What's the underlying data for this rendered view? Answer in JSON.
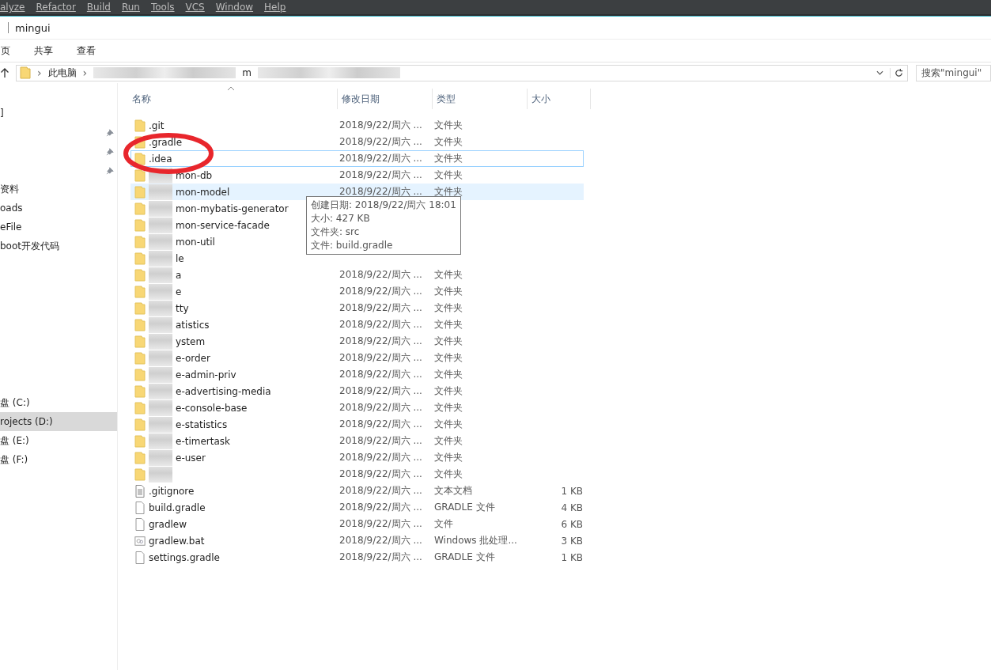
{
  "ide_menu": [
    "alyze",
    "Refactor",
    "Build",
    "Run",
    "Tools",
    "VCS",
    "Window",
    "Help"
  ],
  "window": {
    "title": "mingui"
  },
  "ribbon_tabs": [
    {
      "label": "页",
      "selected": false
    },
    {
      "label": "共享",
      "selected": false
    },
    {
      "label": "查看",
      "selected": false
    }
  ],
  "address_bar": {
    "segments": [
      {
        "kind": "chevron",
        "text": "›"
      },
      {
        "kind": "text",
        "text": "此电脑"
      },
      {
        "kind": "chevron",
        "text": "›"
      },
      {
        "kind": "redacted"
      },
      {
        "kind": "text",
        "text": "m"
      },
      {
        "kind": "redacted"
      }
    ]
  },
  "search": {
    "placeholder": "搜索\"mingui\""
  },
  "sidebar": {
    "items": [
      {
        "label": "]",
        "pinned": false,
        "selected": false
      },
      {
        "pinned": true,
        "selected": false
      },
      {
        "pinned": true,
        "selected": false
      },
      {
        "pinned": true,
        "selected": false
      },
      {
        "label": "资料",
        "pinned": false,
        "selected": false
      },
      {
        "label": "oads",
        "pinned": false,
        "selected": false
      },
      {
        "label": "eFile",
        "pinned": false,
        "selected": false
      },
      {
        "label": "boot开发代码",
        "pinned": false,
        "selected": false
      }
    ],
    "drives": [
      {
        "label": "盘 (C:)",
        "selected": false
      },
      {
        "label": "rojects (D:)",
        "selected": true
      },
      {
        "label": "盘 (E:)",
        "selected": false
      },
      {
        "label": "盘 (F:)",
        "selected": false
      }
    ]
  },
  "table": {
    "columns": [
      "名称",
      "修改日期",
      "类型",
      "大小"
    ],
    "rows": [
      {
        "kind": "folder",
        "name": ".git",
        "redacted": false,
        "date": "2018/9/22/周六 ...",
        "type": "文件夹",
        "focused": false,
        "hovered": false
      },
      {
        "kind": "folder",
        "name": ".gradle",
        "redacted": false,
        "date": "2018/9/22/周六 ...",
        "type": "文件夹",
        "focused": false,
        "hovered": false
      },
      {
        "kind": "folder",
        "name": ".idea",
        "redacted": false,
        "date": "2018/9/22/周六 ...",
        "type": "文件夹",
        "focused": true,
        "hovered": false
      },
      {
        "kind": "folder",
        "name": "mon-db",
        "redacted": true,
        "date": "2018/9/22/周六 ...",
        "type": "文件夹",
        "focused": false,
        "hovered": false
      },
      {
        "kind": "folder",
        "name": "mon-model",
        "redacted": true,
        "date": "2018/9/22/周六 ...",
        "type": "文件夹",
        "focused": false,
        "hovered": true
      },
      {
        "kind": "folder",
        "name": "mon-mybatis-generator",
        "redacted": true,
        "focused": false,
        "hovered": false
      },
      {
        "kind": "folder",
        "name": "mon-service-facade",
        "redacted": true,
        "focused": false,
        "hovered": false
      },
      {
        "kind": "folder",
        "name": "mon-util",
        "redacted": true,
        "focused": false,
        "hovered": false
      },
      {
        "kind": "folder",
        "name": "le",
        "redacted": true,
        "focused": false,
        "hovered": false
      },
      {
        "kind": "folder",
        "name": "a",
        "redacted": true,
        "date": "2018/9/22/周六 ...",
        "type": "文件夹",
        "focused": false,
        "hovered": false
      },
      {
        "kind": "folder",
        "name": "e",
        "redacted": true,
        "date": "2018/9/22/周六 ...",
        "type": "文件夹",
        "focused": false,
        "hovered": false
      },
      {
        "kind": "folder",
        "name": "tty",
        "redacted": true,
        "date": "2018/9/22/周六 ...",
        "type": "文件夹",
        "focused": false,
        "hovered": false
      },
      {
        "kind": "folder",
        "name": "atistics",
        "redacted": true,
        "date": "2018/9/22/周六 ...",
        "type": "文件夹",
        "focused": false,
        "hovered": false
      },
      {
        "kind": "folder",
        "name": "ystem",
        "redacted": true,
        "date": "2018/9/22/周六 ...",
        "type": "文件夹",
        "focused": false,
        "hovered": false
      },
      {
        "kind": "folder",
        "name": "e-order",
        "redacted": true,
        "date": "2018/9/22/周六 ...",
        "type": "文件夹",
        "focused": false,
        "hovered": false
      },
      {
        "kind": "folder",
        "name": "e-admin-priv",
        "redacted": true,
        "date": "2018/9/22/周六 ...",
        "type": "文件夹",
        "focused": false,
        "hovered": false
      },
      {
        "kind": "folder",
        "name": "e-advertising-media",
        "redacted": true,
        "date": "2018/9/22/周六 ...",
        "type": "文件夹",
        "focused": false,
        "hovered": false
      },
      {
        "kind": "folder",
        "name": "e-console-base",
        "redacted": true,
        "date": "2018/9/22/周六 ...",
        "type": "文件夹",
        "focused": false,
        "hovered": false
      },
      {
        "kind": "folder",
        "name": "e-statistics",
        "redacted": true,
        "date": "2018/9/22/周六 ...",
        "type": "文件夹",
        "focused": false,
        "hovered": false
      },
      {
        "kind": "folder",
        "name": "e-timertask",
        "redacted": true,
        "date": "2018/9/22/周六 ...",
        "type": "文件夹",
        "focused": false,
        "hovered": false
      },
      {
        "kind": "folder",
        "name": "e-user",
        "redacted": true,
        "date": "2018/9/22/周六 ...",
        "type": "文件夹",
        "focused": false,
        "hovered": false
      },
      {
        "kind": "folder",
        "redacted": true,
        "date": "2018/9/22/周六 ...",
        "type": "文件夹",
        "focused": false,
        "hovered": false
      },
      {
        "kind": "text",
        "name": ".gitignore",
        "redacted": false,
        "date": "2018/9/22/周六 ...",
        "type": "文本文档",
        "size": "1 KB",
        "focused": false,
        "hovered": false
      },
      {
        "kind": "file",
        "name": "build.gradle",
        "redacted": false,
        "date": "2018/9/22/周六 ...",
        "type": "GRADLE 文件",
        "size": "4 KB",
        "focused": false,
        "hovered": false
      },
      {
        "kind": "file",
        "name": "gradlew",
        "redacted": false,
        "date": "2018/9/22/周六 ...",
        "type": "文件",
        "size": "6 KB",
        "focused": false,
        "hovered": false
      },
      {
        "kind": "batch",
        "name": "gradlew.bat",
        "redacted": false,
        "date": "2018/9/22/周六 ...",
        "type": "Windows 批处理...",
        "size": "3 KB",
        "focused": false,
        "hovered": false
      },
      {
        "kind": "file",
        "name": "settings.gradle",
        "redacted": false,
        "date": "2018/9/22/周六 ...",
        "type": "GRADLE 文件",
        "size": "1 KB",
        "focused": false,
        "hovered": false
      }
    ]
  },
  "tooltip": {
    "lines": [
      "创建日期: 2018/9/22/周六 18:01",
      "大小: 427 KB",
      "文件夹: src",
      "文件: build.gradle"
    ]
  },
  "annotation": {
    "kind": "ellipse"
  }
}
